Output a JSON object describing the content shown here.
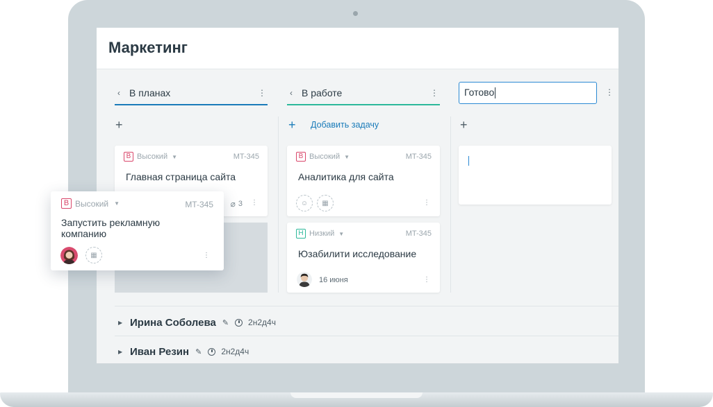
{
  "page": {
    "title": "Маркетинг"
  },
  "columns": [
    {
      "label": "В планах"
    },
    {
      "label": "В работе",
      "add_task": "Добавить задачу"
    },
    {
      "input_value": "Готово"
    }
  ],
  "cards": {
    "plan_main": {
      "priority_letter": "В",
      "priority": "Высокий",
      "code": "MT-345",
      "title": "Главная страница сайта",
      "attachments": "3"
    },
    "dragged": {
      "priority_letter": "В",
      "priority": "Высокий",
      "code": "MT-345",
      "title": "Запустить рекламную компанию"
    },
    "work_analytics": {
      "priority_letter": "В",
      "priority": "Высокий",
      "code": "MT-345",
      "title": "Аналитика  для сайта"
    },
    "work_ux": {
      "priority_letter": "Н",
      "priority": "Низкий",
      "code": "MT-345",
      "title": "Юзабилити исследование",
      "date": "16 июня"
    }
  },
  "groups": [
    {
      "name": "Ирина Соболева",
      "time": "2н2д4ч"
    },
    {
      "name": "Иван Резин",
      "time": "2н2д4ч"
    }
  ],
  "colors": {
    "accent_blue": "#1a7bb9",
    "accent_teal": "#2cb89a",
    "priority_high": "#d9466a"
  }
}
